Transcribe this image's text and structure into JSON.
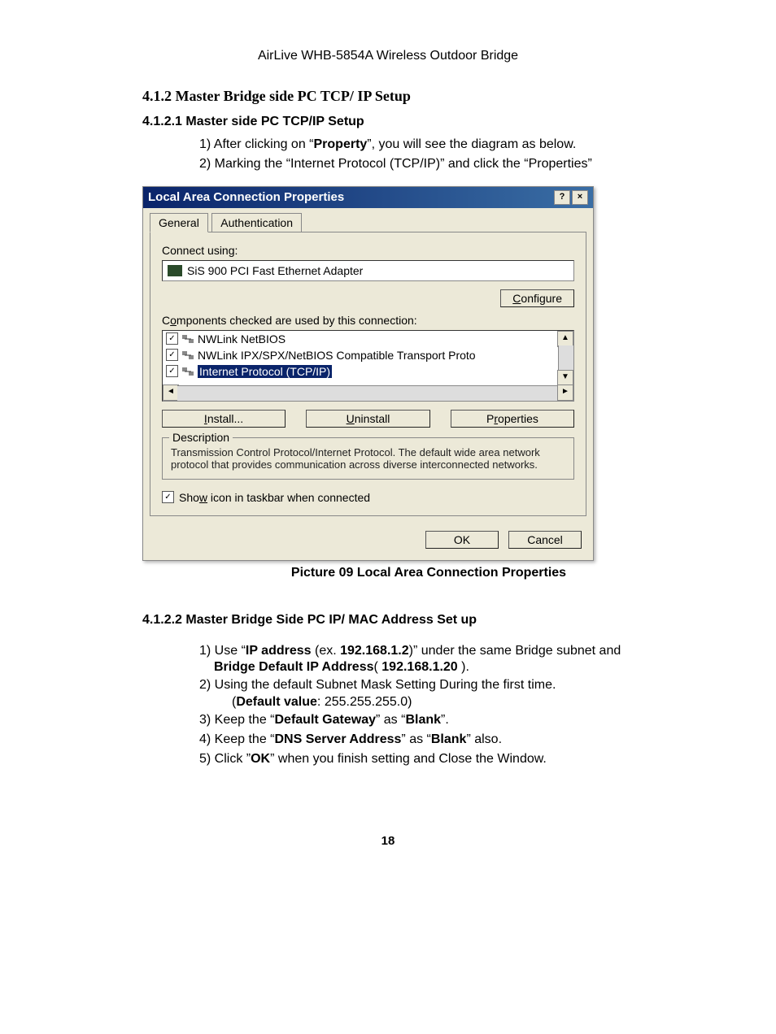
{
  "page": {
    "header": "AirLive WHB-5854A Wireless Outdoor Bridge",
    "section_heading": "4.1.2 Master Bridge side PC TCP/ IP Setup",
    "sub_heading_1": "4.1.2.1 Master side PC TCP/IP Setup",
    "step1a": "1) After clicking on “",
    "step1_bold": "Property",
    "step1b": "”, you will see the diagram as below.",
    "step2": "2) Marking the “Internet Protocol (TCP/IP)” and click the “Properties”",
    "caption": "Picture 09 Local Area Connection Properties",
    "sub_heading_2": "4.1.2.2 Master Bridge Side PC IP/ MAC Address Set up",
    "s1_a": "1) Use “",
    "s1_bold1": "IP address",
    "s1_b": " (ex. ",
    "s1_bold2": "192.168.1.2",
    "s1_c": ")” under the same Bridge subnet and ",
    "s1_bold3": "Bridge Default IP Address",
    "s1_d": "( ",
    "s1_bold4": "192.168.1.20",
    "s1_e": " ).",
    "s2_a": "2) Using the default Subnet Mask Setting During the first time.",
    "s2_b": "(",
    "s2_bold": "Default value",
    "s2_c": ": 255.255.255.0)",
    "s3_a": "3) Keep the “",
    "s3_bold1": "Default Gateway",
    "s3_b": "” as “",
    "s3_bold2": "Blank",
    "s3_c": "”.",
    "s4_a": "4) Keep the “",
    "s4_bold1": "DNS Server Address",
    "s4_b": "” as “",
    "s4_bold2": "Blank",
    "s4_c": "” also.",
    "s5_a": "5) Click ”",
    "s5_bold": "OK",
    "s5_b": "” when you finish setting and Close the Window.",
    "page_number": "18"
  },
  "dialog": {
    "title": "Local Area Connection Properties",
    "tab_general": "General",
    "tab_auth": "Authentication",
    "connect_using": "Connect using:",
    "adapter": "SiS 900 PCI Fast Ethernet Adapter",
    "configure_btn": "Configure",
    "components_label": "Components checked are used by this connection:",
    "comp1": "NWLink NetBIOS",
    "comp2": "NWLink IPX/SPX/NetBIOS Compatible Transport Proto",
    "comp3": "Internet Protocol (TCP/IP)",
    "install_btn": "Install...",
    "uninstall_btn": "Uninstall",
    "properties_btn": "Properties",
    "desc_legend": "Description",
    "desc_text": "Transmission Control Protocol/Internet Protocol. The default wide area network protocol that provides communication across diverse interconnected networks.",
    "show_icon": "Show icon in taskbar when connected",
    "ok_btn": "OK",
    "cancel_btn": "Cancel"
  }
}
